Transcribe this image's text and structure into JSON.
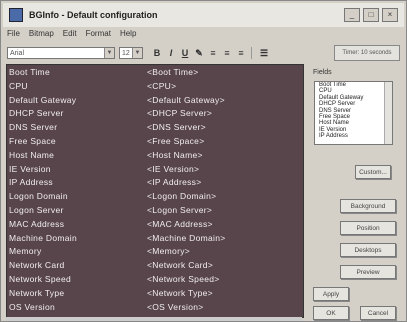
{
  "window": {
    "title": "BGInfo - Default configuration",
    "controls": [
      "_",
      "□",
      "×"
    ]
  },
  "menu": [
    "File",
    "Bitmap",
    "Edit",
    "Format",
    "Help"
  ],
  "toolbar": {
    "font": "Arial",
    "size": "12",
    "format_buttons": [
      "B",
      "I",
      "U",
      "✎",
      "≡",
      "≡",
      "≡",
      "☰"
    ],
    "help_button": "Timer: 10 seconds"
  },
  "editor": {
    "rows": [
      {
        "label": "Boot Time",
        "value": "<Boot Time>"
      },
      {
        "label": "CPU",
        "value": "<CPU>"
      },
      {
        "label": "Default Gateway",
        "value": "<Default Gateway>"
      },
      {
        "label": "DHCP Server",
        "value": "<DHCP Server>"
      },
      {
        "label": "DNS Server",
        "value": "<DNS Server>"
      },
      {
        "label": "Free Space",
        "value": "<Free Space>"
      },
      {
        "label": "Host Name",
        "value": "<Host Name>"
      },
      {
        "label": "IE Version",
        "value": "<IE Version>"
      },
      {
        "label": "IP Address",
        "value": "<IP Address>"
      },
      {
        "label": "Logon Domain",
        "value": "<Logon Domain>"
      },
      {
        "label": "Logon Server",
        "value": "<Logon Server>"
      },
      {
        "label": "MAC Address",
        "value": "<MAC Address>"
      },
      {
        "label": "Machine Domain",
        "value": "<Machine Domain>"
      },
      {
        "label": "Memory",
        "value": "<Memory>"
      },
      {
        "label": "Network Card",
        "value": "<Network Card>"
      },
      {
        "label": "Network Speed",
        "value": "<Network Speed>"
      },
      {
        "label": "Network Type",
        "value": "<Network Type>"
      },
      {
        "label": "OS Version",
        "value": "<OS Version>"
      }
    ]
  },
  "fields": {
    "label": "Fields",
    "items": [
      "Boot Time",
      "CPU",
      "Default Gateway",
      "DHCP Server",
      "DNS Server",
      "Free Space",
      "Host Name",
      "IE Version",
      "IP Address"
    ]
  },
  "buttons": {
    "custom": "Custom...",
    "background": "Background",
    "position": "Position",
    "desktops": "Desktops",
    "preview": "Preview",
    "apply": "Apply",
    "ok": "OK",
    "cancel": "Cancel"
  },
  "colors": {
    "editor_bg": "#57454b",
    "editor_text": "#f2eef0"
  }
}
